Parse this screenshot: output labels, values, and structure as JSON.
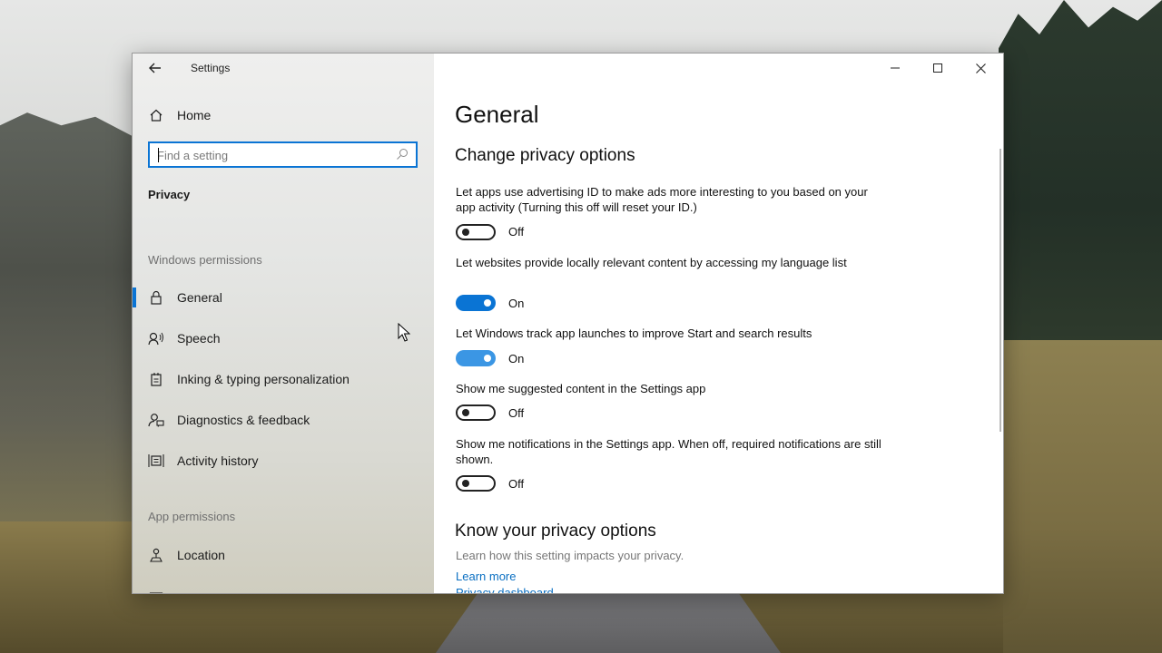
{
  "window": {
    "title": "Settings",
    "controls": {
      "minimize": "minimize-icon",
      "maximize": "maximize-icon",
      "close": "close-icon"
    }
  },
  "sidebar": {
    "home_label": "Home",
    "search_placeholder": "Find a setting",
    "section_title": "Privacy",
    "windows_permissions_label": "Windows permissions",
    "items": [
      {
        "label": "General",
        "icon": "lock-icon",
        "selected": true
      },
      {
        "label": "Speech",
        "icon": "speech-icon",
        "selected": false
      },
      {
        "label": "Inking & typing personalization",
        "icon": "inking-icon",
        "selected": false
      },
      {
        "label": "Diagnostics & feedback",
        "icon": "diagnostics-icon",
        "selected": false
      },
      {
        "label": "Activity history",
        "icon": "activity-history-icon",
        "selected": false
      }
    ],
    "app_permissions_label": "App permissions",
    "app_items": [
      {
        "label": "Location",
        "icon": "location-icon"
      }
    ]
  },
  "main": {
    "title": "General",
    "section_title": "Change privacy options",
    "settings": [
      {
        "description": "Let apps use advertising ID to make ads more interesting to you based on your app activity (Turning this off will reset your ID.)",
        "state": "Off"
      },
      {
        "description": "Let websites provide locally relevant content by accessing my language list",
        "state": "On"
      },
      {
        "description": "Let Windows track app launches to improve Start and search results",
        "state": "On"
      },
      {
        "description": "Show me suggested content in the Settings app",
        "state": "Off"
      },
      {
        "description": "Show me notifications in the Settings app. When off, required notifications are still shown.",
        "state": "Off"
      }
    ],
    "know_title": "Know your privacy options",
    "know_desc": "Learn how this setting impacts your privacy.",
    "learn_more": "Learn more",
    "privacy_dashboard": "Privacy dashboard"
  },
  "colors": {
    "accent": "#0a74d4",
    "link": "#0a6fc2"
  }
}
